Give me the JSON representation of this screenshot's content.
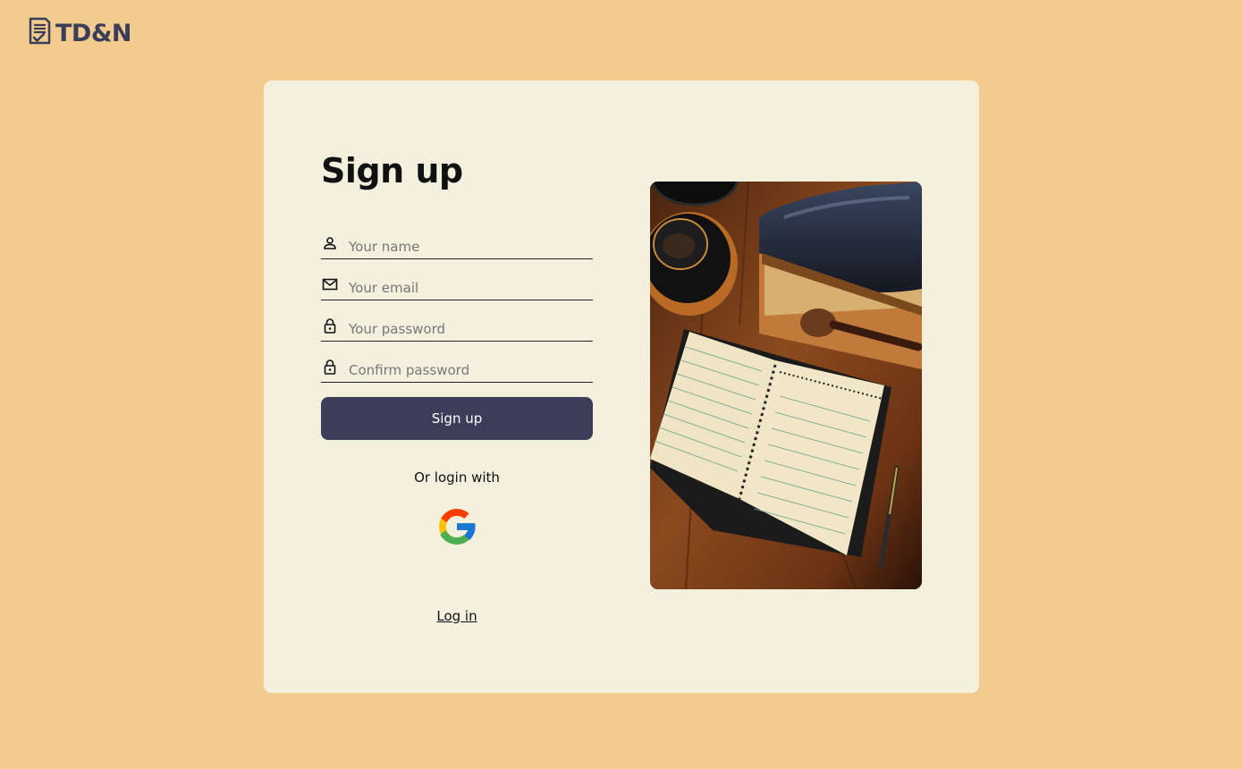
{
  "brand": {
    "name": "TD&N",
    "icon": "checklist-document-icon"
  },
  "signup": {
    "title": "Sign up",
    "fields": [
      {
        "icon": "person-icon",
        "placeholder": "Your name",
        "value": ""
      },
      {
        "icon": "mail-icon",
        "placeholder": "Your email",
        "value": ""
      },
      {
        "icon": "lock-icon",
        "placeholder": "Your password",
        "value": ""
      },
      {
        "icon": "lock-icon",
        "placeholder": "Confirm password",
        "value": ""
      }
    ],
    "submit_label": "Sign up",
    "alt_login_text": "Or login with",
    "google_icon": "google-icon",
    "login_link": "Log in"
  },
  "colors": {
    "background": "#f2cb8f",
    "card": "#f4f0de",
    "accent": "#3b3d59"
  }
}
